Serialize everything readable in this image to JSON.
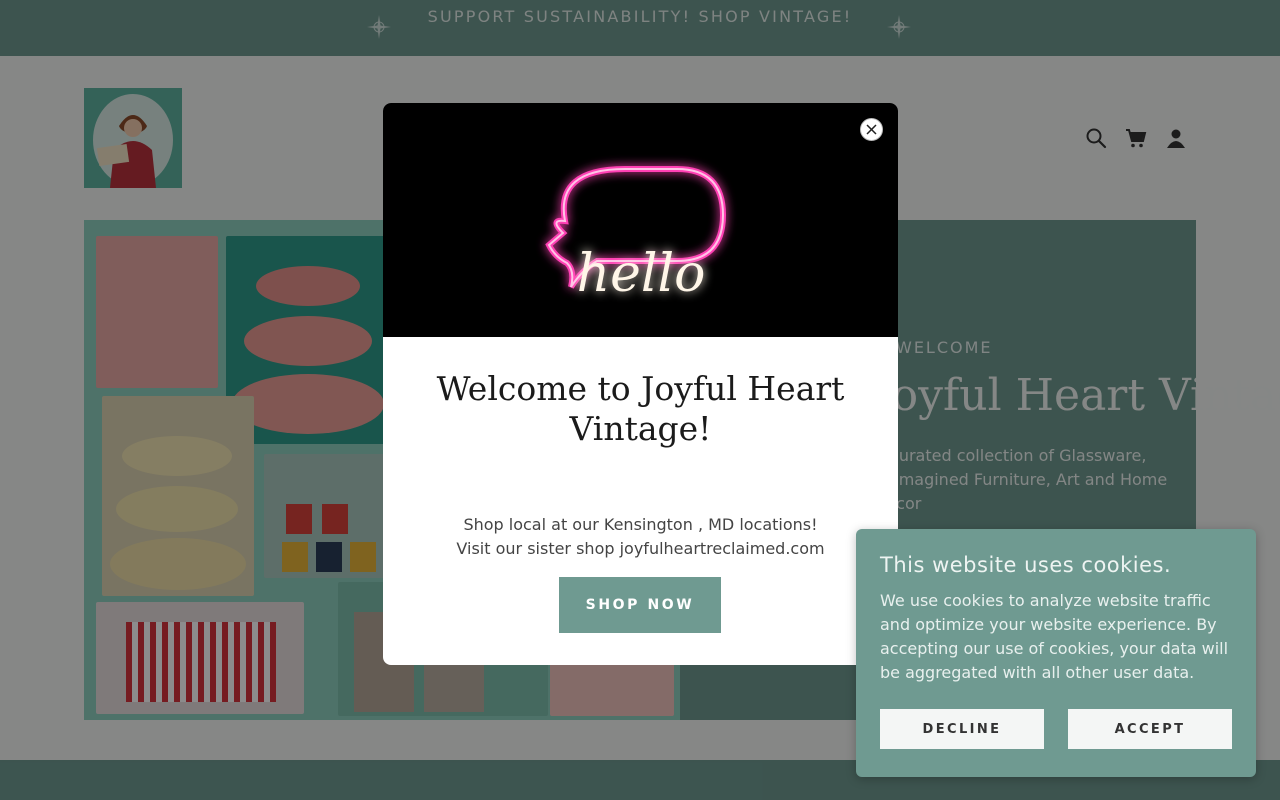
{
  "announcement": {
    "text": "SUPPORT SUSTAINABILITY! SHOP VINTAGE!"
  },
  "header": {
    "icons": [
      "search-icon",
      "cart-icon",
      "account-icon"
    ]
  },
  "hero": {
    "subtitle": "WELCOME",
    "title": "Joyful Heart Vintage",
    "description": "A curated collection of Glassware, Reimagined Furniture,  Art and Home Decor"
  },
  "modal": {
    "image_text": "hello",
    "title": "Welcome to Joyful Heart Vintage!",
    "line1": "Shop local at our Kensington , MD locations!",
    "line2": "Visit our sister shop joyfulheartreclaimed.com",
    "button_label": "SHOP NOW"
  },
  "cookie": {
    "title": "This website uses cookies.",
    "text": "We use cookies to analyze website traffic and optimize your website experience. By accepting our use of cookies, your data will be aggregated with all other user data.",
    "decline_label": "DECLINE",
    "accept_label": "ACCEPT"
  },
  "colors": {
    "brand_teal": "#6f9a91",
    "collage_bg": "#8fd0c0",
    "neon_pink": "#ff3fb4"
  }
}
